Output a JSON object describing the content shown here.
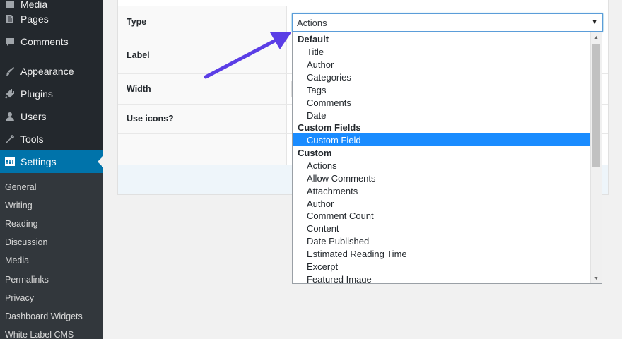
{
  "sidebar": {
    "menu": [
      {
        "label": "Media",
        "icon": "media-icon"
      },
      {
        "label": "Pages",
        "icon": "pages-icon"
      },
      {
        "label": "Comments",
        "icon": "comments-icon"
      },
      {
        "label": "Appearance",
        "icon": "appearance-icon"
      },
      {
        "label": "Plugins",
        "icon": "plugins-icon"
      },
      {
        "label": "Users",
        "icon": "users-icon"
      },
      {
        "label": "Tools",
        "icon": "tools-icon"
      },
      {
        "label": "Settings",
        "icon": "settings-icon"
      }
    ],
    "submenu": [
      "General",
      "Writing",
      "Reading",
      "Discussion",
      "Media",
      "Permalinks",
      "Privacy",
      "Dashboard Widgets",
      "White Label CMS"
    ]
  },
  "form": {
    "rows": [
      "Type",
      "Label",
      "Width",
      "Use icons?"
    ]
  },
  "select": {
    "value": "Actions"
  },
  "dropdown": {
    "groups": [
      {
        "label": "Default",
        "options": [
          "Title",
          "Author",
          "Categories",
          "Tags",
          "Comments",
          "Date"
        ]
      },
      {
        "label": "Custom Fields",
        "options": [
          "Custom Field"
        ]
      },
      {
        "label": "Custom",
        "options": [
          "Actions",
          "Allow Comments",
          "Attachments",
          "Author",
          "Comment Count",
          "Content",
          "Date Published",
          "Estimated Reading Time",
          "Excerpt",
          "Featured Image"
        ]
      }
    ],
    "selected": "Custom Field"
  },
  "colors": {
    "sidebar": "#23282d",
    "active": "#0073aa",
    "highlight": "#1a8cff",
    "arrow": "#5b3ee6"
  }
}
